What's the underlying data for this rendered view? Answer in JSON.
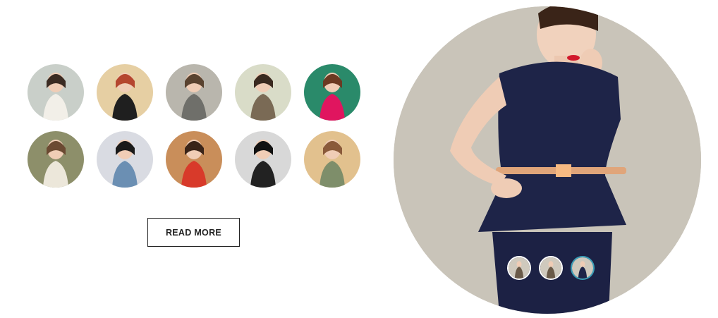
{
  "gallery": {
    "thumbnails": [
      {
        "icon": "model-photo-icon",
        "bg": "#c9cfc9",
        "fg": "#f2efe8",
        "hair": "#3b2b22"
      },
      {
        "icon": "model-photo-icon",
        "bg": "#e6cfa3",
        "fg": "#1f1f1f",
        "hair": "#b5462f"
      },
      {
        "icon": "model-photo-icon",
        "bg": "#b9b6ad",
        "fg": "#6f6f6a",
        "hair": "#5a4330"
      },
      {
        "icon": "model-photo-icon",
        "bg": "#d9dcc8",
        "fg": "#7a6a55",
        "hair": "#3a2a20"
      },
      {
        "icon": "model-photo-icon",
        "bg": "#2a8a6a",
        "fg": "#e0155f",
        "hair": "#6b3a22"
      },
      {
        "icon": "model-photo-icon",
        "bg": "#8d8f6a",
        "fg": "#ece7da",
        "hair": "#6b4a32"
      },
      {
        "icon": "model-photo-icon",
        "bg": "#d9dbe2",
        "fg": "#6b8fb3",
        "hair": "#1a1a1a"
      },
      {
        "icon": "model-photo-icon",
        "bg": "#c98e5a",
        "fg": "#d83a2a",
        "hair": "#3a2418"
      },
      {
        "icon": "model-photo-icon",
        "bg": "#d8d8d8",
        "fg": "#222222",
        "hair": "#111111"
      },
      {
        "icon": "model-photo-icon",
        "bg": "#e2c18e",
        "fg": "#7e8e6a",
        "hair": "#8a5a3a"
      }
    ]
  },
  "read_more": {
    "label": "READ MORE"
  },
  "hero": {
    "icon": "model-in-navy-dress-photo",
    "bg": "#c9c4b9",
    "dress": "#1e2448",
    "skin": "#f1d2bd"
  },
  "slider": {
    "dots": [
      {
        "icon": "slide-thumb-icon",
        "active": false
      },
      {
        "icon": "slide-thumb-icon",
        "active": false
      },
      {
        "icon": "slide-thumb-icon",
        "active": true
      }
    ]
  }
}
